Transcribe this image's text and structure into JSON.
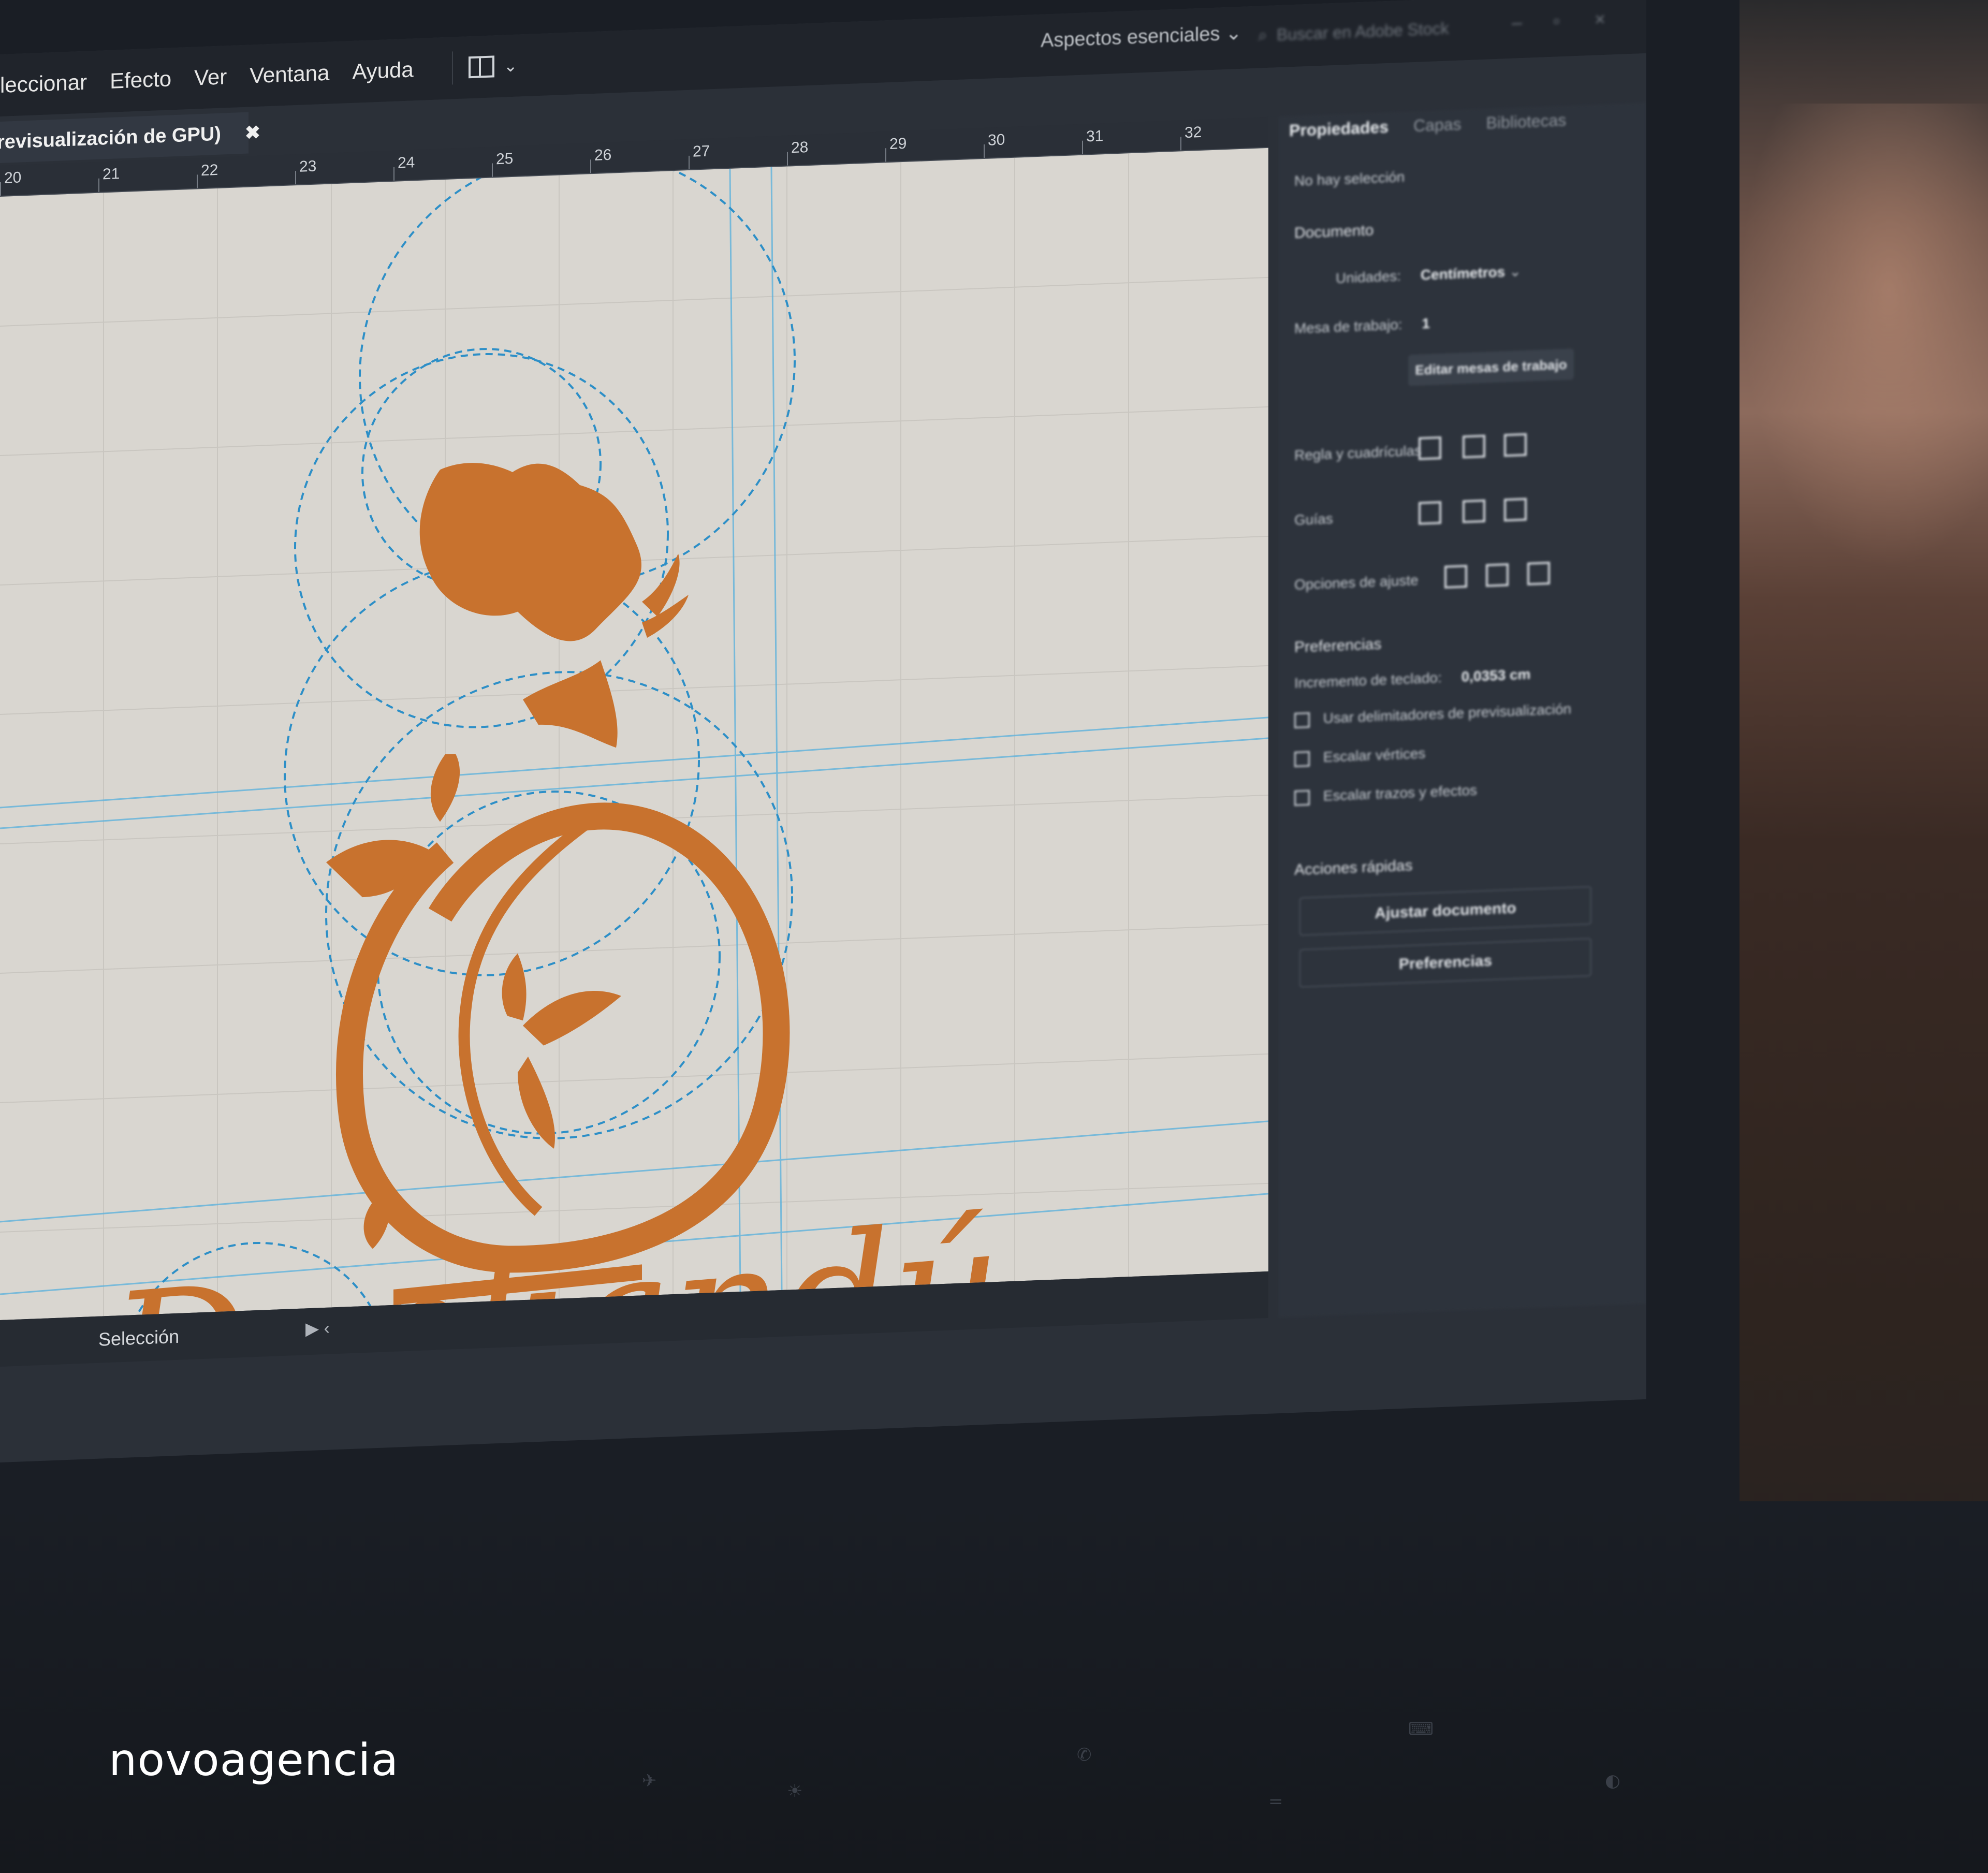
{
  "menubar": {
    "items": [
      "leccionar",
      "Efecto",
      "Ver",
      "Ventana",
      "Ayuda"
    ],
    "workspace": "Aspectos esenciales",
    "search_placeholder": "Buscar en Adobe Stock"
  },
  "document_tab": {
    "label": "revisualización de GPU)",
    "close": "✖"
  },
  "ruler": {
    "numbers": [
      "20",
      "21",
      "22",
      "23",
      "24",
      "25",
      "26",
      "27",
      "28",
      "29",
      "30",
      "31",
      "32"
    ]
  },
  "artwork": {
    "wordmark": "Dunkandú",
    "color": "#c8722e",
    "guide_color": "#2d8fc7"
  },
  "status_bar": {
    "tool": "Selección",
    "play_icon": "play-icon",
    "prev_icon": "chevron-left-icon"
  },
  "properties_panel": {
    "tabs": [
      "Propiedades",
      "Capas",
      "Bibliotecas"
    ],
    "no_selection": "No hay selección",
    "document_heading": "Documento",
    "units_label": "Unidades:",
    "units_value": "Centímetros",
    "artboard_label": "Mesa de trabajo:",
    "artboard_value": "1",
    "edit_artboards_button": "Editar mesas de trabajo",
    "rulers_label": "Regla y cuadrículas",
    "guides_label": "Guías",
    "snap_label": "Opciones de ajuste",
    "preferences_heading": "Preferencias",
    "keyboard_increment_label": "Incremento de teclado:",
    "keyboard_increment_value": "0,0353 cm",
    "checkboxes": [
      "Usar delimitadores de previsualización",
      "Escalar vértices",
      "Escalar trazos y efectos"
    ],
    "quick_actions_heading": "Acciones rápidas",
    "fit_document_button": "Ajustar documento",
    "preferences_button": "Preferencias"
  },
  "watermark": "novoagencia",
  "colors": {
    "bezel": "#1a1e25",
    "artboard": "#d9d6d0",
    "panel": "#2d333c",
    "accent": "#c8722e"
  }
}
